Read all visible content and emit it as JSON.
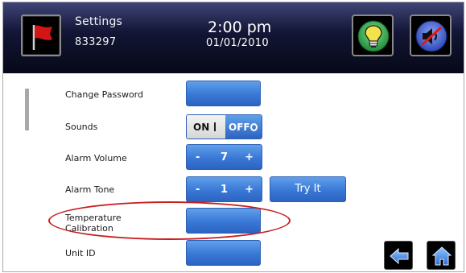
{
  "header": {
    "title": "Settings",
    "subtitle": "833297",
    "time": "2:00 pm",
    "date": "01/01/2010",
    "flag_icon": "red-flag-icon",
    "buttons": [
      {
        "icon": "lightbulb-icon",
        "color": "#2ea84a"
      },
      {
        "icon": "speaker-muted-icon",
        "color": "#3a56c8"
      }
    ]
  },
  "settings": {
    "change_password": {
      "label": "Change Password"
    },
    "sounds": {
      "label": "Sounds",
      "on_label": "ON",
      "off_label": "OFF",
      "selected": "OFF"
    },
    "alarm_volume": {
      "label": "Alarm Volume",
      "minus": "-",
      "value": "7",
      "plus": "+"
    },
    "alarm_tone": {
      "label": "Alarm Tone",
      "minus": "-",
      "value": "1",
      "plus": "+",
      "try_label": "Try It"
    },
    "temperature_calibration": {
      "label_line1": "Temperature",
      "label_line2": "Calibration",
      "highlighted": true
    },
    "unit_id": {
      "label": "Unit ID"
    }
  },
  "footer": {
    "back_icon": "arrow-left-icon",
    "home_icon": "home-icon"
  },
  "colors": {
    "accent_blue": "#3a78d6",
    "highlight_red": "#c81e1e",
    "header_bg": "#121533"
  }
}
